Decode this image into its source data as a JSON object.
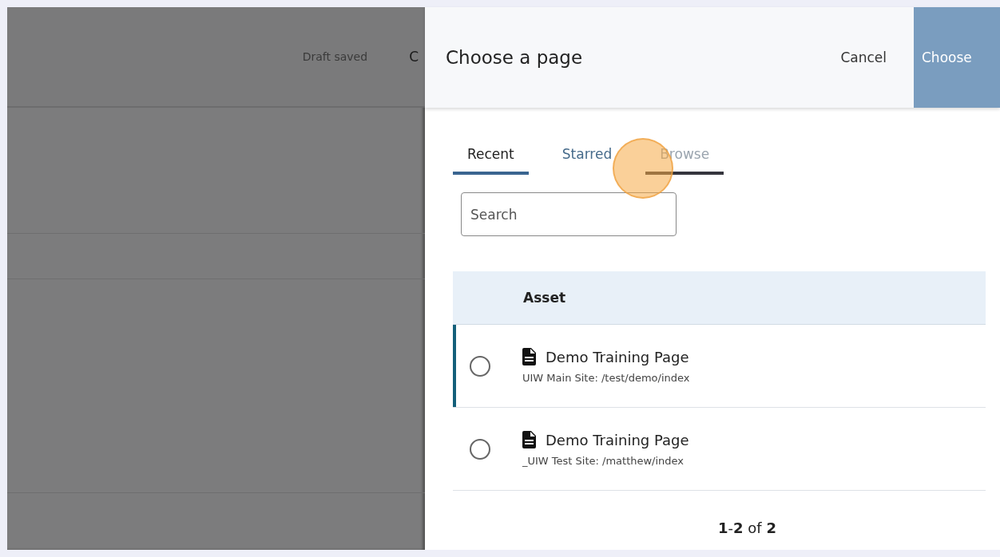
{
  "background": {
    "status": "Draft saved",
    "cut_button": "C"
  },
  "dialog": {
    "title": "Choose a page",
    "cancel": "Cancel",
    "confirm": "Choose",
    "tabs": [
      {
        "label": "Recent",
        "selected": true,
        "hovered": false
      },
      {
        "label": "Starred",
        "selected": false,
        "hovered": false
      },
      {
        "label": "Browse",
        "selected": false,
        "hovered": true
      }
    ],
    "search": {
      "placeholder": "Search"
    },
    "table": {
      "columns": [
        "Asset"
      ],
      "rows": [
        {
          "title": "Demo Training Page",
          "path": "UIW Main Site: /test/demo/index",
          "selected": false,
          "focused": true
        },
        {
          "title": "Demo Training Page",
          "path": "_UIW Test Site: /matthew/index",
          "selected": false,
          "focused": false
        }
      ]
    },
    "pager": "**1**-**2** of **2**"
  }
}
